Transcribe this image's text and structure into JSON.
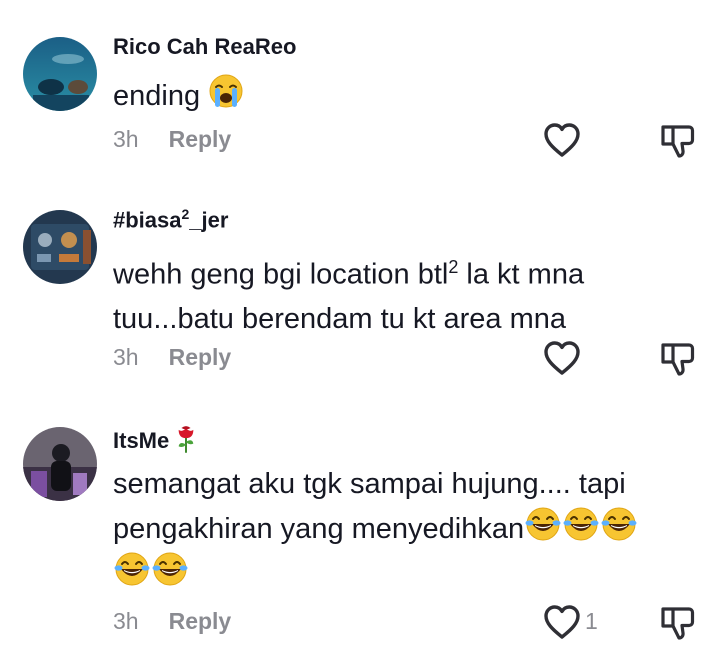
{
  "comments": [
    {
      "username": "Rico Cah ReaReo",
      "text": "ending",
      "emoji": [
        "crying-face-emoji"
      ],
      "time": "3h",
      "reply_label": "Reply",
      "likes": ""
    },
    {
      "username_pre": "#biasa",
      "username_sup": "2",
      "username_post": "_jer",
      "text_line1_pre": "wehh geng bgi location btl",
      "text_line1_sup": "2",
      "text_line1_post": " la kt mna",
      "text_line2": "tuu...batu berendam tu kt area mna",
      "time": "3h",
      "reply_label": "Reply",
      "likes": ""
    },
    {
      "username": "ItsMe",
      "username_emoji": "rose-emoji",
      "text_line1": "semangat aku tgk sampai hujung.... tapi",
      "text_line2": "pengakhiran yang menyedihkan",
      "text_emojis": [
        "tears-of-joy-emoji",
        "tears-of-joy-emoji",
        "tears-of-joy-emoji",
        "tears-of-joy-emoji",
        "tears-of-joy-emoji"
      ],
      "time": "3h",
      "reply_label": "Reply",
      "likes": "1"
    }
  ],
  "icons": {
    "like": "heart-outline-icon",
    "dislike": "thumbs-down-icon"
  },
  "colors": {
    "text": "#161823",
    "muted": "#8a8b91",
    "icon": "#2f2f35"
  }
}
